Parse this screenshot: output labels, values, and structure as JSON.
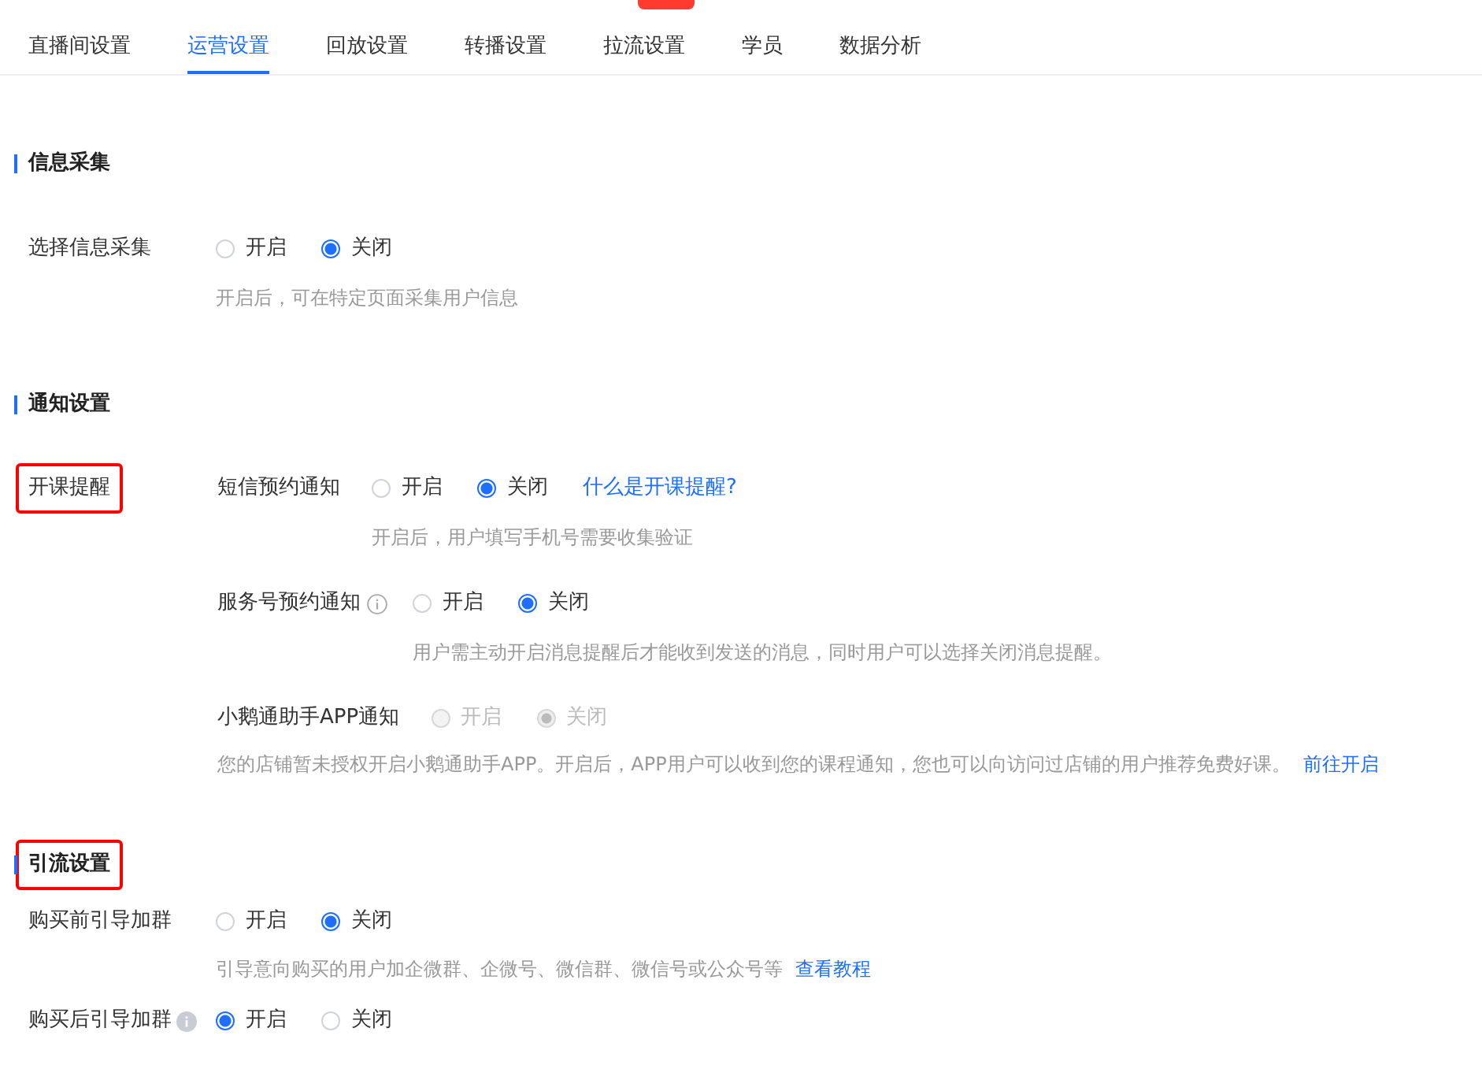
{
  "tabs": [
    {
      "label": "直播间设置",
      "selected": false,
      "badge": false
    },
    {
      "label": "运营设置",
      "selected": true,
      "badge": false
    },
    {
      "label": "回放设置",
      "selected": false,
      "badge": false
    },
    {
      "label": "转播设置",
      "selected": false,
      "badge": false
    },
    {
      "label": "拉流设置",
      "selected": false,
      "badge": true
    },
    {
      "label": "学员",
      "selected": false,
      "badge": false
    },
    {
      "label": "数据分析",
      "selected": false,
      "badge": false
    }
  ],
  "sections": [
    {
      "title": "信息采集",
      "highlighted": false,
      "rows": [
        {
          "label": "选择信息采集",
          "options": [
            {
              "label": "开启",
              "selected": false
            },
            {
              "label": "关闭",
              "selected": true
            }
          ],
          "hint": "开启后，可在特定页面采集用户信息"
        }
      ]
    },
    {
      "title": "通知设置",
      "highlighted": false,
      "groups": [
        {
          "label": "开课提醒",
          "highlighted": true,
          "rows": [
            {
              "kind": "aligned",
              "label": "短信预约通知",
              "disabled": false,
              "options": [
                {
                  "label": "开启",
                  "selected": false
                },
                {
                  "label": "关闭",
                  "selected": true
                }
              ],
              "link": "什么是开课提醒?",
              "hint": "开启后，用户填写手机号需要收集验证"
            },
            {
              "kind": "aligned",
              "label": "服务号预约通知",
              "info": true,
              "disabled": false,
              "options": [
                {
                  "label": "开启",
                  "selected": false
                },
                {
                  "label": "关闭",
                  "selected": true
                }
              ],
              "hint": "用户需主动开启消息提醒后才能收到发送的消息，同时用户可以选择关闭消息提醒。"
            },
            {
              "kind": "wide",
              "label": "小鹅通助手APP通知",
              "disabled": true,
              "options": [
                {
                  "label": "开启",
                  "selected": false
                },
                {
                  "label": "关闭",
                  "selected": true
                }
              ],
              "hint": "您的店铺暂未授权开启小鹅通助手APP。开启后，APP用户可以收到您的课程通知，您也可以向访问过店铺的用户推荐免费好课。",
              "hint_link": "前往开启"
            }
          ]
        }
      ]
    },
    {
      "title": "引流设置",
      "highlighted": true,
      "rows": [
        {
          "label": "购买前引导加群",
          "options": [
            {
              "label": "开启",
              "selected": false
            },
            {
              "label": "关闭",
              "selected": true
            }
          ],
          "hint": "引导意向购买的用户加企微群、企微号、微信群、微信号或公众号等",
          "hint_link": "查看教程"
        },
        {
          "label": "购买后引导加群",
          "info": true,
          "options": [
            {
              "label": "开启",
              "selected": true
            },
            {
              "label": "关闭",
              "selected": false
            }
          ]
        }
      ]
    }
  ]
}
